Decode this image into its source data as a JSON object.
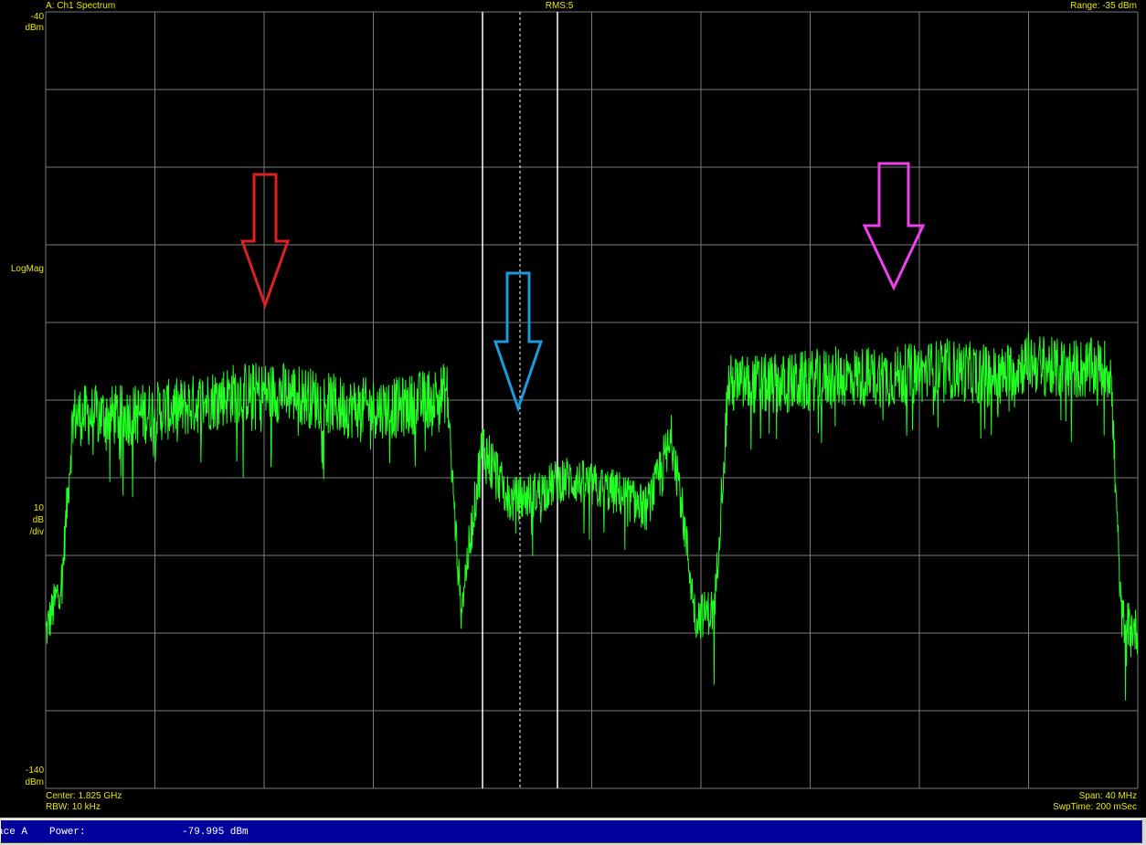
{
  "header": {
    "trace_title": "A: Ch1 Spectrum",
    "detector": "RMS:5",
    "range": "Range: -35 dBm"
  },
  "y_axis": {
    "top_value": "-40",
    "top_unit": "dBm",
    "scale_type": "LogMag",
    "scale_per_div_value": "10",
    "scale_per_div_unit": "dB",
    "scale_per_div_suffix": "/div",
    "bottom_value": "-140",
    "bottom_unit": "dBm"
  },
  "footer": {
    "center": "Center: 1.825 GHz",
    "rbw": "RBW: 10 kHz",
    "span": "Span: 40 MHz",
    "sweep_time": "SwpTime: 200 mSec"
  },
  "status": {
    "trace_label": "ace A",
    "power_label": "Power:",
    "power_value": "-79.995 dBm"
  },
  "colors": {
    "trace": "#22ff22",
    "grid": "#7a7a7a",
    "text": "#e8e800",
    "arrow_left": "#e02020",
    "arrow_center": "#1a9be0",
    "arrow_right": "#f040f0",
    "status_bg": "#00009c"
  },
  "chart_data": {
    "type": "line",
    "title": "A: Ch1 Spectrum",
    "xlabel": "",
    "ylabel": "LogMag",
    "ylim": [
      -140,
      -40
    ],
    "xlim_mhz": [
      1805,
      1845
    ],
    "grid": true,
    "series": [
      {
        "values_note": "",
        "x": [
          1805,
          1805.6,
          1806,
          1808,
          1810,
          1812,
          1814,
          1816,
          1818,
          1819.7,
          1820.2,
          1821,
          1822,
          1823,
          1824,
          1825,
          1826,
          1827,
          1828,
          1828.8,
          1829.5,
          1830,
          1832,
          1834,
          1836,
          1838,
          1840,
          1841,
          1842,
          1843,
          1844,
          1844.4,
          1845
        ],
        "y": [
          -120,
          -113,
          -92,
          -92,
          -91,
          -89,
          -89,
          -91,
          -91,
          -89,
          -117,
          -96,
          -103,
          -102,
          -100,
          -101,
          -102,
          -104,
          -95,
          -118,
          -117,
          -88,
          -88,
          -87,
          -87,
          -86,
          -87,
          -85,
          -86,
          -86,
          -86,
          -118,
          -120
        ]
      }
    ]
  }
}
